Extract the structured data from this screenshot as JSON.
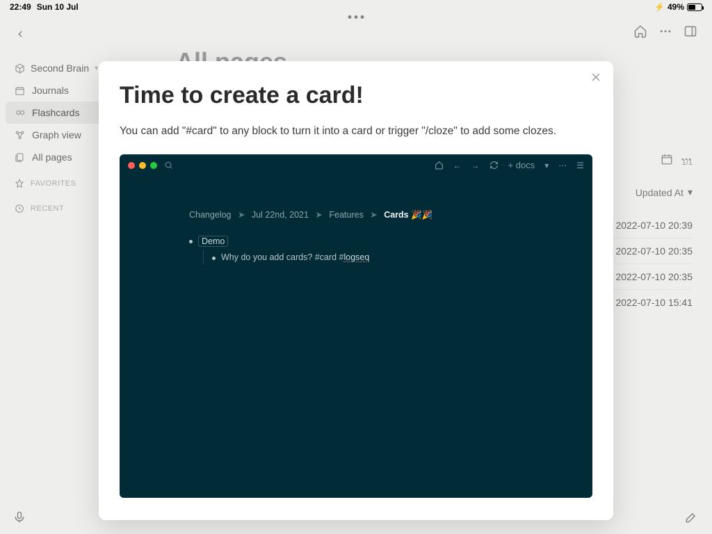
{
  "status": {
    "time": "22:49",
    "date": "Sun 10 Jul",
    "battery_pct": "49%"
  },
  "sidebar": {
    "workspace": "Second Brain",
    "items": [
      {
        "label": "Journals"
      },
      {
        "label": "Flashcards"
      },
      {
        "label": "Graph view"
      },
      {
        "label": "All pages"
      }
    ],
    "sections": {
      "favorites": "FAVORITES",
      "recent": "RECENT"
    }
  },
  "page": {
    "title": "All pages",
    "counter": "1/1",
    "updated_header": "Updated At",
    "rows": [
      "2022-07-10 20:39",
      "2022-07-10 20:35",
      "2022-07-10 20:35",
      "2022-07-10 15:41"
    ]
  },
  "modal": {
    "title": "Time to create a card!",
    "body": "You can add \"#card\" to any block to turn it into a card or trigger \"/cloze\" to add some clozes.",
    "demo": {
      "breadcrumb": {
        "a": "Changelog",
        "b": "Jul 22nd, 2021",
        "c": "Features",
        "d": "Cards 🎉🎉"
      },
      "bullet1": "Demo",
      "bullet2_pre": "Why do you add cards? #card #",
      "bullet2_tag": "logseq",
      "add_docs": "+ docs"
    }
  },
  "icons": {
    "lightning": "⚡"
  }
}
